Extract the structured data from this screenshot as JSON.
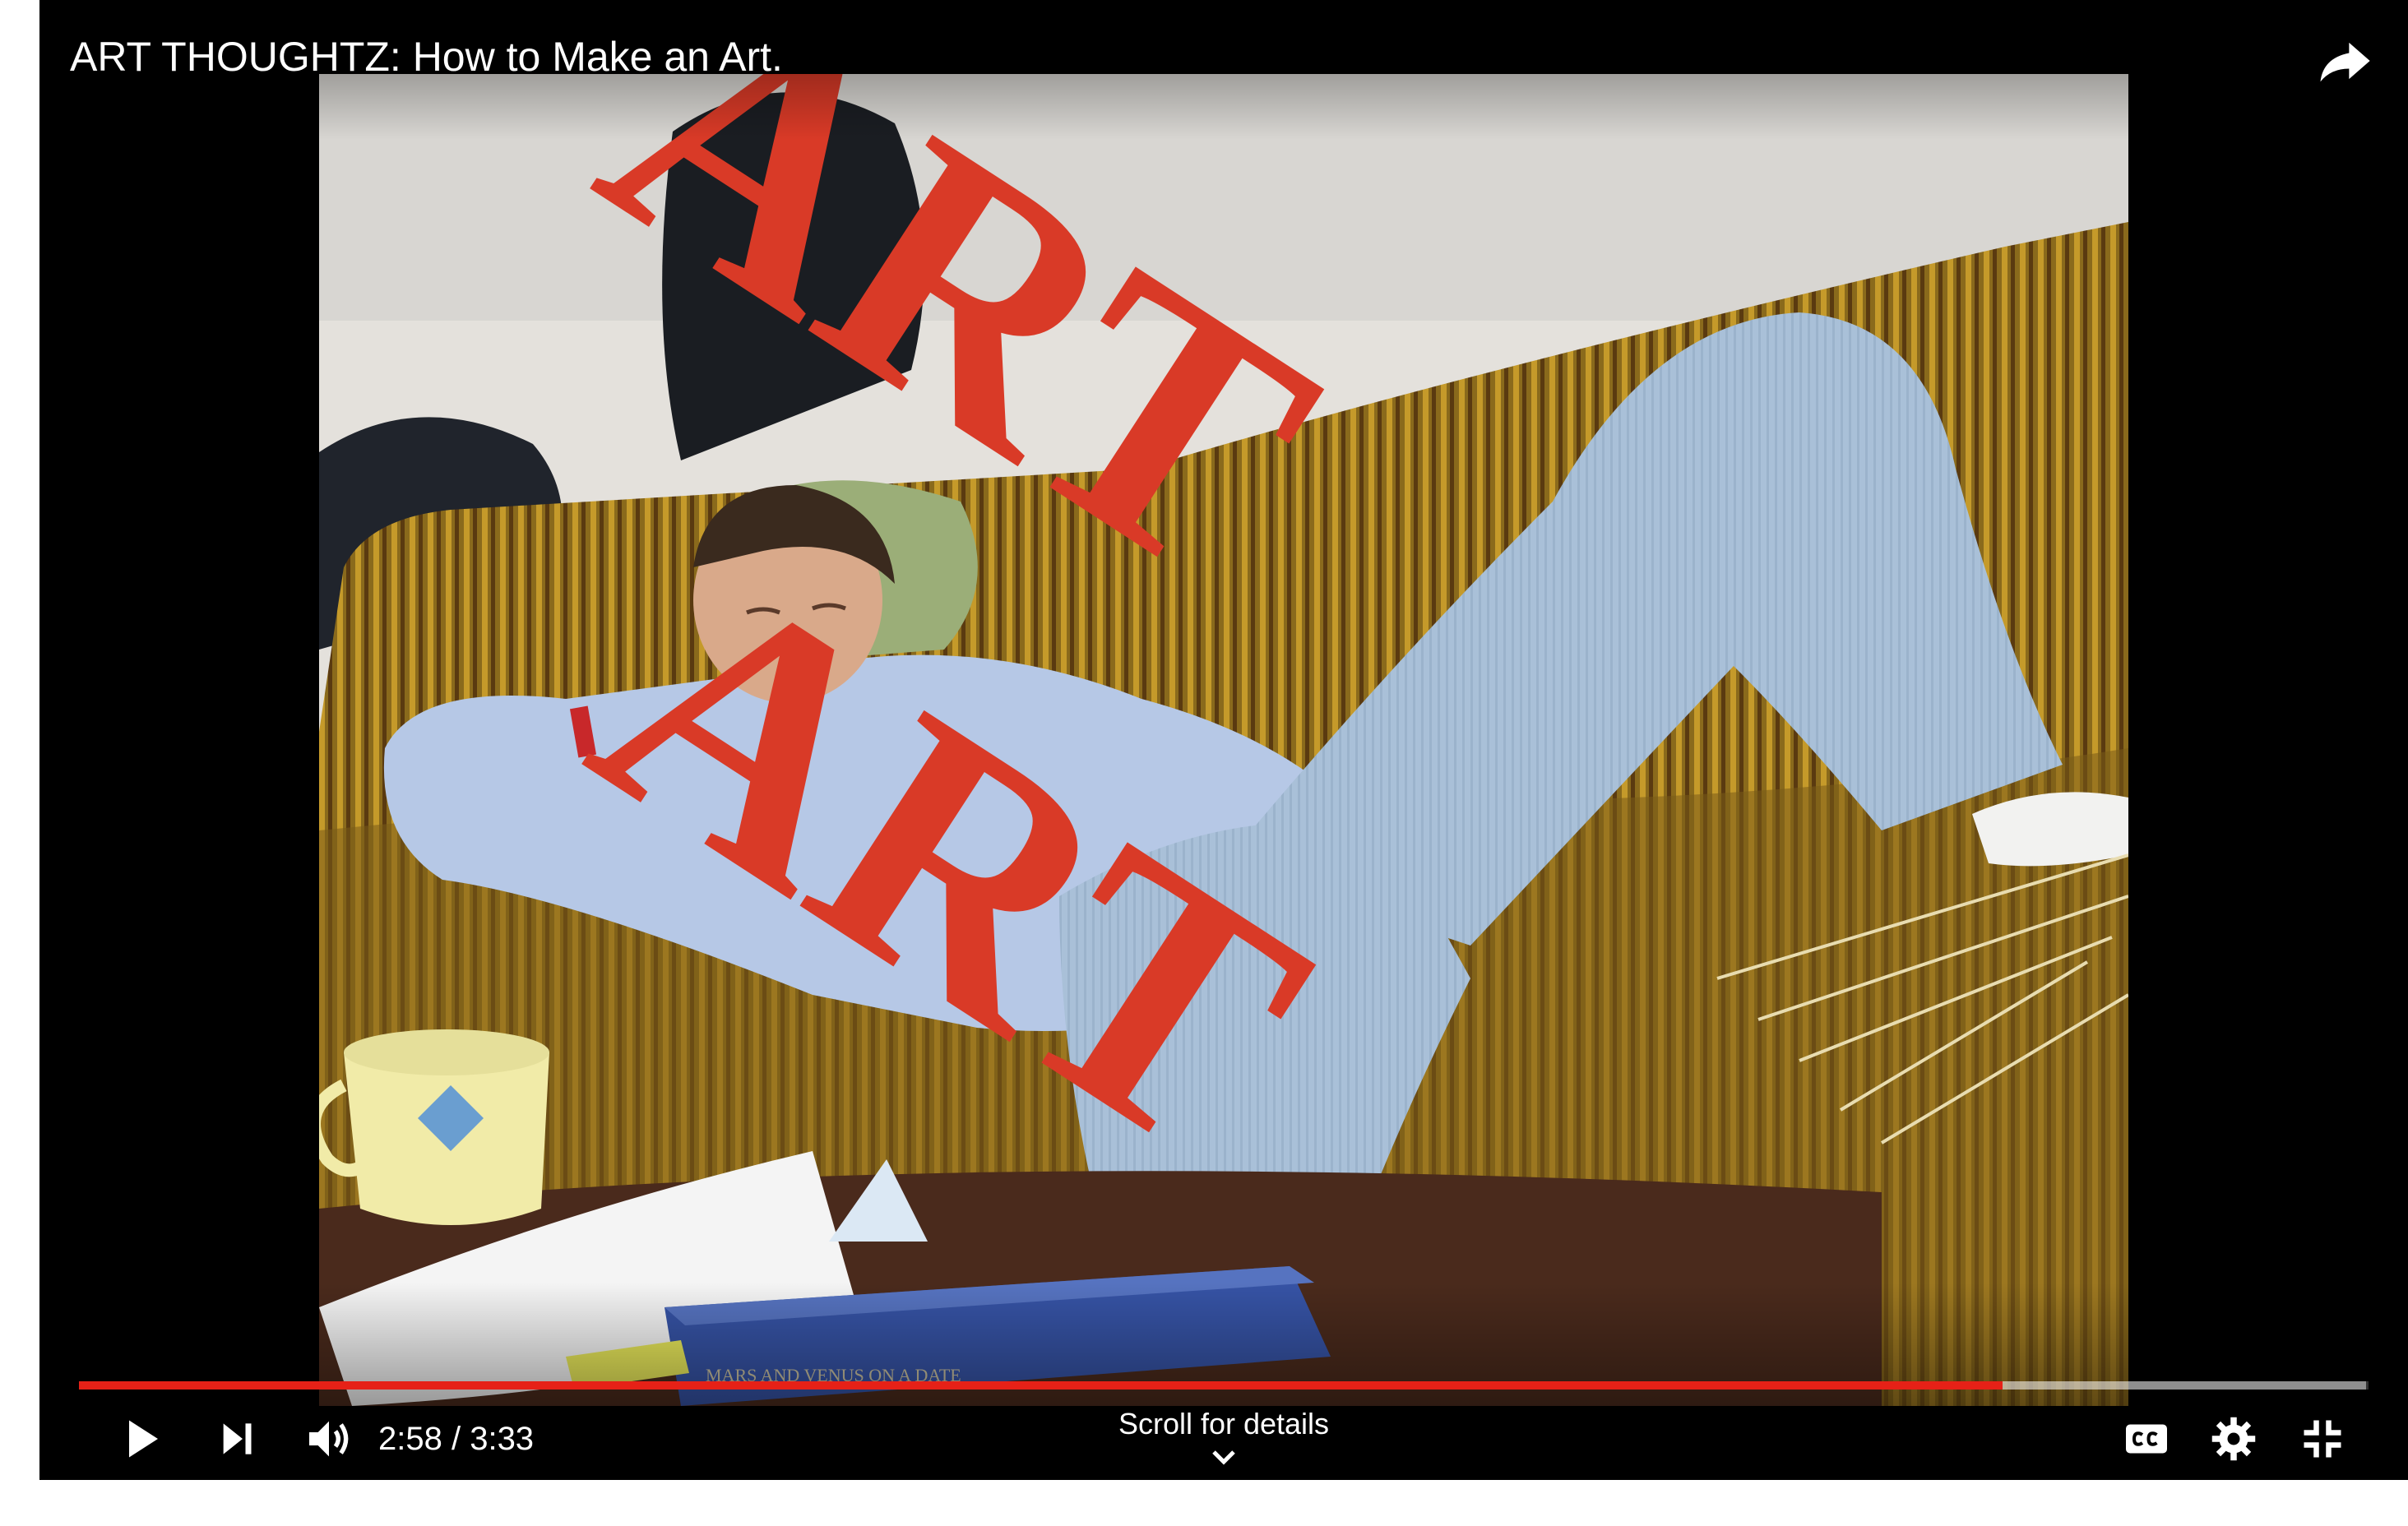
{
  "video": {
    "title": "ART THOUGHTZ: How to Make an Art.",
    "overlay_text_top": "ART",
    "overlay_text_bottom": "ART",
    "book_spine_text": "MARS AND VENUS ON A DATE"
  },
  "progress": {
    "played_fraction": 0.84,
    "buffered_fraction": 0.999
  },
  "controls": {
    "time_current": "2:58",
    "time_separator": " / ",
    "time_duration": "3:33",
    "scroll_hint": "Scroll for details",
    "icons": [
      "play-icon",
      "next-icon",
      "volume-icon",
      "cc-icon",
      "settings-icon",
      "exit-fullscreen-icon",
      "share-icon",
      "chevron-down-icon"
    ]
  },
  "colors": {
    "progress_played": "#e62117",
    "overlay_text": "#d93a27",
    "controls_text": "#ffffff"
  }
}
